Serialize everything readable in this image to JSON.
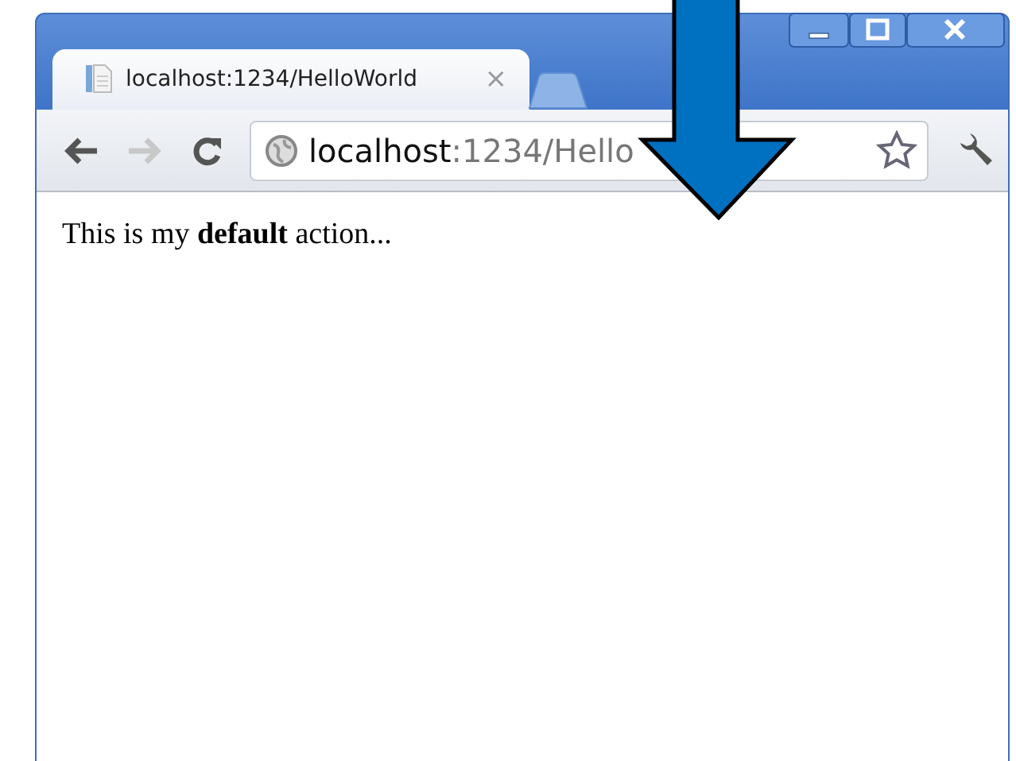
{
  "tabs": [
    {
      "title": "localhost:1234/HelloWorld",
      "close": "×",
      "selected": true
    }
  ],
  "address": {
    "host": "localhost",
    "path": ":1234/Hello"
  },
  "content": {
    "text": "This is my **default** action..."
  }
}
